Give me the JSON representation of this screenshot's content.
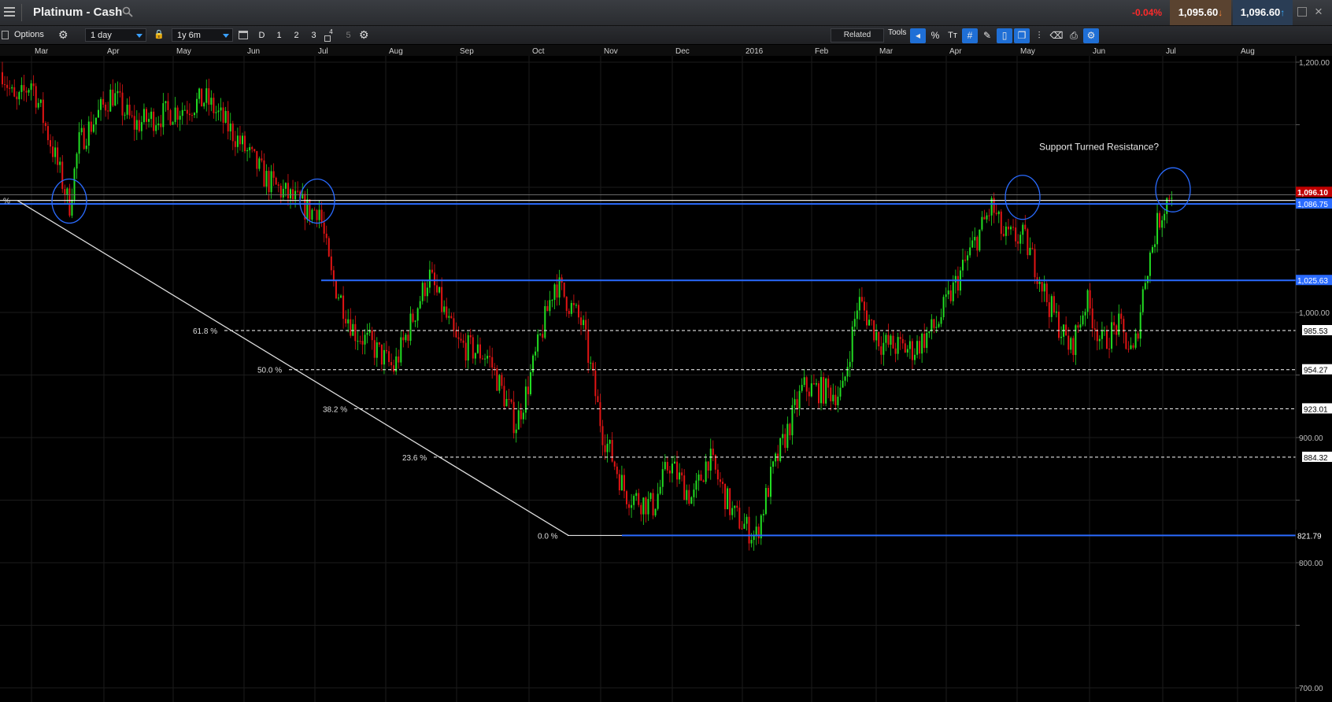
{
  "window": {
    "title": "Platinum - Cash",
    "change_pct": "-0.04%",
    "sell_price": "1,095.60",
    "buy_price": "1,096.60"
  },
  "toolbar": {
    "options_label": "Options",
    "interval": "1 day",
    "range": "1y 6m",
    "period_buttons": [
      "D",
      "1",
      "2",
      "3",
      "4",
      "5"
    ],
    "related_label": "Related",
    "tools_label": "Tools"
  },
  "colors": {
    "up": "#22dd22",
    "down": "#e21414",
    "support_line": "#2a6bff",
    "fib_line": "#ffffff",
    "last_price_badge": "#c00000",
    "highlight_circle": "#2a6bff"
  },
  "icons": [
    "menu-icon",
    "search-icon",
    "gear-icon",
    "lock-icon",
    "calendar-icon",
    "close-icon",
    "restore-icon"
  ],
  "chart_data": {
    "type": "candlestick",
    "x_months": [
      "Mar",
      "Apr",
      "May",
      "Jun",
      "Jul",
      "Aug",
      "Sep",
      "Oct",
      "Nov",
      "Dec",
      "2016",
      "Feb",
      "Mar",
      "Apr",
      "May",
      "Jun",
      "Jul",
      "Aug"
    ],
    "y_ticks": [
      "1,200.00",
      "1,000.00",
      "900.00",
      "800.00",
      "700.00"
    ],
    "ylim": [
      700,
      1200
    ],
    "horizontal_levels": [
      "1,086.75",
      "1,025.63",
      "821.79"
    ],
    "last_price": "1,096.10",
    "fibonacci": {
      "prefix": "%",
      "levels": [
        {
          "label": "61.8 %",
          "value": "985.53"
        },
        {
          "label": "50.0 %",
          "value": "954.27"
        },
        {
          "label": "38.2 %",
          "value": "923.01"
        },
        {
          "label": "23.6 %",
          "value": "884.32"
        },
        {
          "label": "0.0 %",
          "value": "821.79"
        }
      ]
    },
    "annotation": "Support Turned Resistance?"
  }
}
